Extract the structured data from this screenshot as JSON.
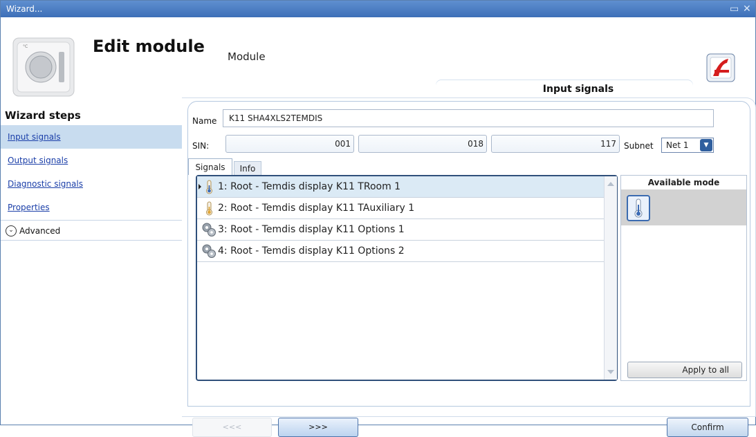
{
  "window": {
    "title": "Wizard...",
    "controls": [
      "restore-icon",
      "close-icon"
    ]
  },
  "header": {
    "title": "Edit module",
    "subtitle": "Module",
    "tab_label": "Input signals"
  },
  "wizard_steps": {
    "title": "Wizard steps",
    "items": [
      {
        "label": "Input signals",
        "active": true
      },
      {
        "label": "Output signals",
        "active": false
      },
      {
        "label": "Diagnostic signals",
        "active": false
      },
      {
        "label": "Properties",
        "active": false
      }
    ],
    "advanced_label": "Advanced"
  },
  "form": {
    "name_label": "Name",
    "name_value": "K11 SHA4XLS2TEMDIS",
    "sin_label": "SIN:",
    "sin_values": [
      "001",
      "018",
      "117"
    ],
    "subnet_label": "Subnet",
    "subnet_value": "Net 1"
  },
  "tabs": [
    {
      "label": "Signals",
      "active": true
    },
    {
      "label": "Info",
      "active": false
    }
  ],
  "signals": [
    {
      "label": "1: Root - Temdis display K11 TRoom 1",
      "icon": "thermometer-icon",
      "selected": true
    },
    {
      "label": "2: Root - Temdis display K11 TAuxiliary 1",
      "icon": "thermometer-icon",
      "selected": false
    },
    {
      "label": "3: Root - Temdis display K11 Options 1",
      "icon": "gears-icon",
      "selected": false
    },
    {
      "label": "4: Root - Temdis display K11 Options 2",
      "icon": "gears-icon",
      "selected": false
    }
  ],
  "available_mode": {
    "title": "Available mode",
    "mode_icon": "thermometer-icon",
    "apply_label": "Apply to all"
  },
  "nav": {
    "prev_label": "<<<",
    "next_label": ">>>",
    "confirm_label": "Confirm"
  }
}
